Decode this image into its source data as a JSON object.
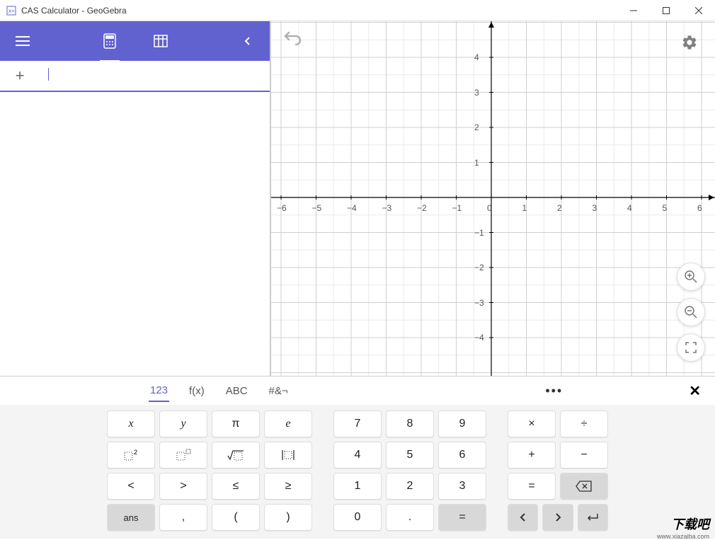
{
  "window": {
    "title": "CAS Calculator - GeoGebra"
  },
  "toolbar": {
    "menu_icon": "menu",
    "calc_icon": "calculator",
    "table_icon": "table",
    "collapse_icon": "chevron-left"
  },
  "input": {
    "plus": "+",
    "value": ""
  },
  "graph": {
    "x_ticks": [
      "−6",
      "−5",
      "−4",
      "−3",
      "−2",
      "−1",
      "0",
      "1",
      "2",
      "3",
      "4",
      "5",
      "6"
    ],
    "y_ticks": [
      "4",
      "3",
      "2",
      "1",
      "−1",
      "−2",
      "−3",
      "−4"
    ]
  },
  "keyboard": {
    "tabs": {
      "num": "123",
      "fx": "f(x)",
      "abc": "ABC",
      "sym": "#&¬"
    },
    "more": "•••",
    "close": "✕",
    "group1": {
      "r1": [
        "x",
        "y",
        "π",
        "e"
      ],
      "r2": [
        "□²",
        "□▫",
        "√▫",
        "|▫|"
      ],
      "r3": [
        "<",
        ">",
        "≤",
        "≥"
      ],
      "r4": [
        "ans",
        ",",
        "(",
        ")"
      ]
    },
    "group2": {
      "r1": [
        "7",
        "8",
        "9"
      ],
      "r2": [
        "4",
        "5",
        "6"
      ],
      "r3": [
        "1",
        "2",
        "3"
      ],
      "r4": [
        "0",
        ".",
        "="
      ]
    },
    "group3": {
      "r1": [
        "×",
        "÷"
      ],
      "r2": [
        "+",
        "−"
      ],
      "r3": [
        "=",
        "⌫"
      ],
      "r4": [
        "<",
        ">",
        "↵"
      ]
    }
  },
  "watermark": {
    "main": "下载吧",
    "sub": "www.xiazaiba.com"
  }
}
